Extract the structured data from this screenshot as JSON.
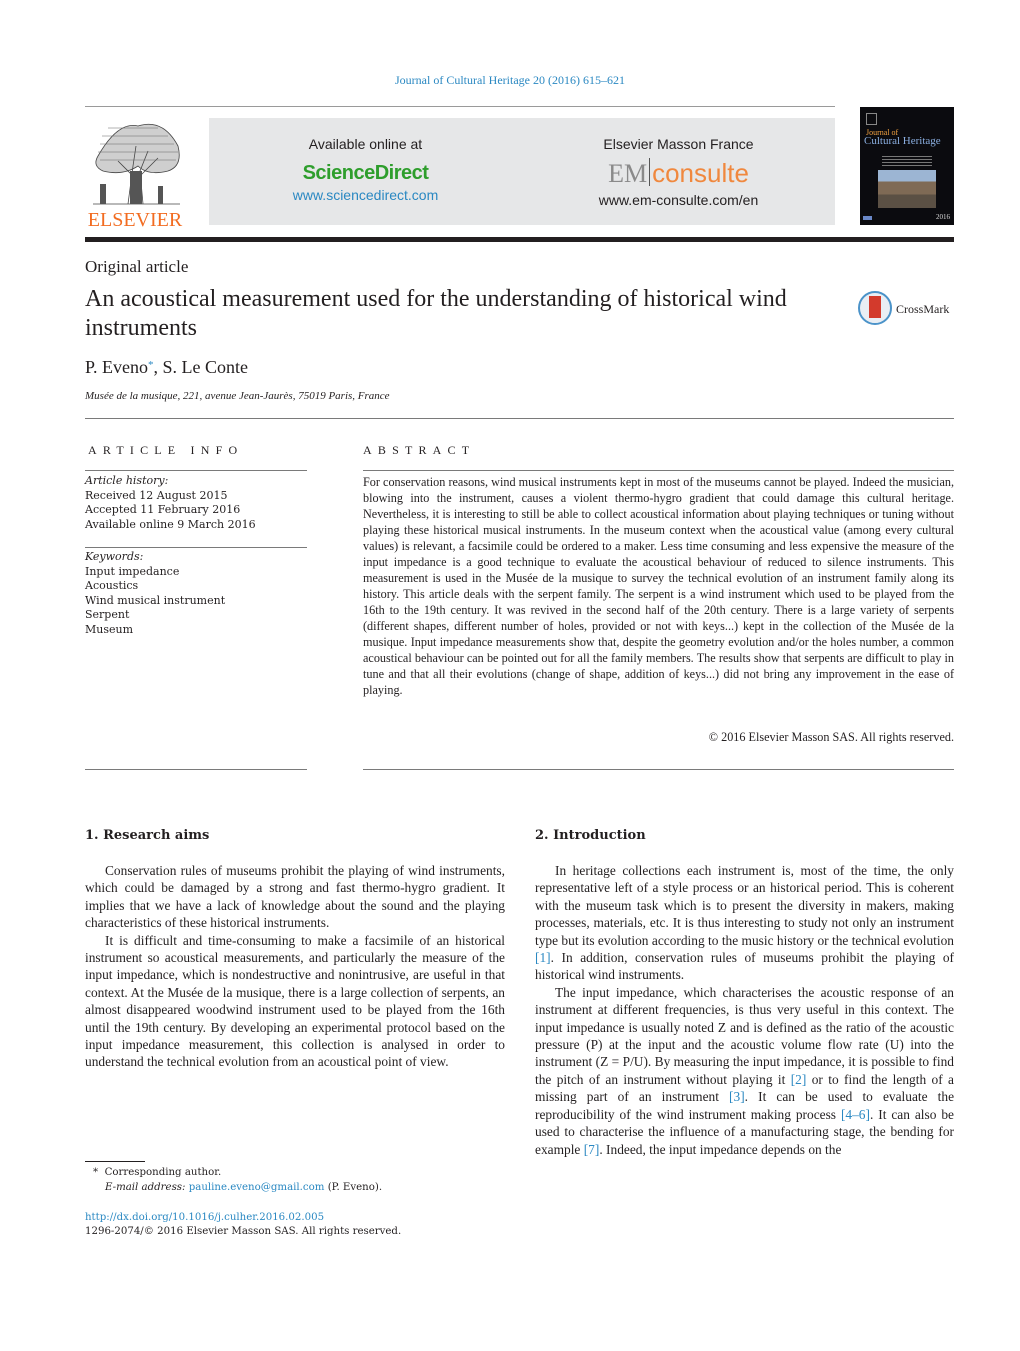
{
  "header": {
    "journal_ref": "Journal of Cultural Heritage 20 (2016) 615–621",
    "publisher_logo_text": "ELSEVIER",
    "banner_left": {
      "caption": "Available online at",
      "brand": "ScienceDirect",
      "url": "www.sciencedirect.com"
    },
    "banner_right": {
      "caption": "Elsevier Masson France",
      "brand_em": "EM",
      "brand_consulte": "consulte",
      "url": "www.em-consulte.com/en"
    },
    "cover": {
      "journal_small": "Journal of",
      "journal_title": "Cultural Heritage",
      "year_mark": "2016"
    },
    "colors": {
      "link": "#2a88c2",
      "elsevier_orange": "#f26c21",
      "sciencedirect_green": "#2e9e2c",
      "emconsulte_orange": "#f0883e",
      "crossmark_red": "#d33a2c"
    }
  },
  "article": {
    "type": "Original article",
    "title": "An acoustical measurement used for the understanding of historical wind instruments",
    "crossmark_label": "CrossMark",
    "authors": [
      {
        "name": "P. Eveno",
        "mark": "*"
      },
      {
        "name": "S. Le Conte",
        "mark": ""
      }
    ],
    "author_separator": ", ",
    "affiliation": "Musée de la musique, 221, avenue Jean-Jaurès, 75019 Paris, France"
  },
  "article_info": {
    "heading": "ARTICLE INFO",
    "history_label": "Article history:",
    "history": [
      "Received 12 August 2015",
      "Accepted 11 February 2016",
      "Available online 9 March 2016"
    ],
    "keywords_label": "Keywords:",
    "keywords": [
      "Input impedance",
      "Acoustics",
      "Wind musical instrument",
      "Serpent",
      "Museum"
    ]
  },
  "abstract": {
    "heading": "ABSTRACT",
    "text": "For conservation reasons, wind musical instruments kept in most of the museums cannot be played. Indeed the musician, blowing into the instrument, causes a violent thermo-hygro gradient that could damage this cultural heritage. Nevertheless, it is interesting to still be able to collect acoustical information about playing techniques or tuning without playing these historical musical instruments. In the museum context when the acoustical value (among every cultural values) is relevant, a facsimile could be ordered to a maker. Less time consuming and less expensive the measure of the input impedance is a good technique to evaluate the acoustical behaviour of reduced to silence instruments. This measurement is used in the Musée de la musique to survey the technical evolution of an instrument family along its history. This article deals with the serpent family. The serpent is a wind instrument which used to be played from the 16th to the 19th century. It was revived in the second half of the 20th century. There is a large variety of serpents (different shapes, different number of holes, provided or not with keys...) kept in the collection of the Musée de la musique. Input impedance measurements show that, despite the geometry evolution and/or the holes number, a common acoustical behaviour can be pointed out for all the family members. The results show that serpents are difficult to play in tune and that all their evolutions (change of shape, addition of keys...) did not bring any improvement in the ease of playing.",
    "copyright": "© 2016 Elsevier Masson SAS. All rights reserved."
  },
  "sections": {
    "research_aims": {
      "title": "1.  Research aims",
      "paragraphs": [
        "Conservation rules of museums prohibit the playing of wind instruments, which could be damaged by a strong and fast thermo-hygro gradient. It implies that we have a lack of knowledge about the sound and the playing characteristics of these historical instruments.",
        "It is difficult and time-consuming to make a facsimile of an historical instrument so acoustical measurements, and particularly the measure of the input impedance, which is nondestructive and nonintrusive, are useful in that context. At the Musée de la musique, there is a large collection of serpents, an almost disappeared woodwind instrument used to be played from the 16th until the 19th century. By developing an experimental protocol based on the input impedance measurement, this collection is analysed in order to understand the technical evolution from an acoustical point of view."
      ]
    },
    "introduction": {
      "title": "2.  Introduction",
      "p1_before_ref1": "In heritage collections each instrument is, most of the time, the only representative left of a style process or an historical period. This is coherent with the museum task which is to present the diversity in makers, making processes, materials, etc. It is thus interesting to study not only an instrument type but its evolution according to the music history or the technical evolution ",
      "ref1": "[1]",
      "p1_after_ref1": ". In addition, conservation rules of museums prohibit the playing of historical wind instruments.",
      "p2_a": "The input impedance, which characterises the acoustic response of an instrument at different frequencies, is thus very useful in this context. The input impedance is usually noted Z and is defined as the ratio of the acoustic pressure (P) at the input and the acoustic volume flow rate (U) into the instrument (Z = P/U). By measuring the input impedance, it is possible to find the pitch of an instrument without playing it ",
      "ref2": "[2]",
      "p2_b": " or to find the length of a missing part of an instrument ",
      "ref3": "[3]",
      "p2_c": ". It can be used to evaluate the reproducibility of the wind instrument making process ",
      "ref4": "[4–6]",
      "p2_d": ". It can also be used to characterise the influence of a manufacturing stage, the bending for example ",
      "ref7": "[7]",
      "p2_e": ". Indeed, the input impedance depends on the"
    }
  },
  "footnotes": {
    "star": "*",
    "corresponding": "Corresponding author.",
    "email_label": "E-mail address:",
    "email": "pauline.eveno@gmail.com",
    "email_owner": "(P. Eveno).",
    "doi": "http://dx.doi.org/10.1016/j.culher.2016.02.005",
    "issn_line": "1296-2074/© 2016 Elsevier Masson SAS. All rights reserved."
  }
}
